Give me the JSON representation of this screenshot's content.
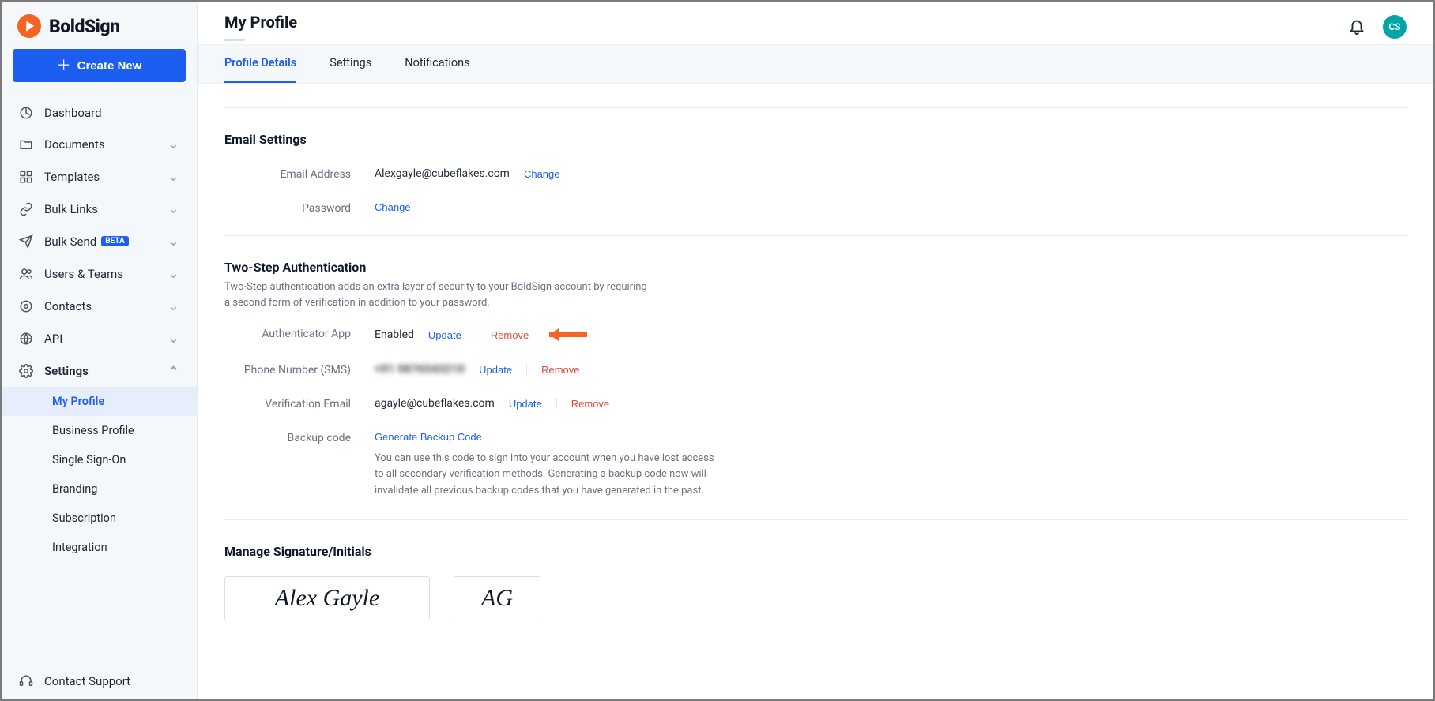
{
  "brand": {
    "name": "BoldSign"
  },
  "createButton": "Create New",
  "nav": {
    "dashboard": "Dashboard",
    "documents": "Documents",
    "templates": "Templates",
    "bulkLinks": "Bulk Links",
    "bulkSend": "Bulk Send",
    "bulkSendBadge": "BETA",
    "usersTeams": "Users & Teams",
    "contacts": "Contacts",
    "api": "API",
    "settings": "Settings",
    "settingsSub": {
      "myProfile": "My Profile",
      "businessProfile": "Business Profile",
      "sso": "Single Sign-On",
      "branding": "Branding",
      "subscription": "Subscription",
      "integration": "Integration"
    },
    "contactSupport": "Contact Support"
  },
  "header": {
    "pageTitle": "My Profile",
    "avatarInitials": "CS"
  },
  "tabs": {
    "profileDetails": "Profile Details",
    "settings": "Settings",
    "notifications": "Notifications"
  },
  "emailSettings": {
    "title": "Email Settings",
    "emailLabel": "Email Address",
    "emailValue": "Alexgayle@cubeflakes.com",
    "emailChange": "Change",
    "passwordLabel": "Password",
    "passwordChange": "Change"
  },
  "twoStep": {
    "title": "Two-Step Authentication",
    "desc": "Two-Step authentication adds an extra layer of security to your BoldSign account by requiring a second form of verification in addition to your password.",
    "authAppLabel": "Authenticator App",
    "authAppStatus": "Enabled",
    "update": "Update",
    "remove": "Remove",
    "phoneLabel": "Phone Number (SMS)",
    "phoneValue": "+91 9876543210",
    "verifEmailLabel": "Verification Email",
    "verifEmailValue": "agayle@cubeflakes.com",
    "backupLabel": "Backup code",
    "backupLink": "Generate Backup Code",
    "backupDesc": "You can use this code to sign into your account when you have lost access to all secondary verification methods. Generating a backup code now will invalidate all previous backup codes that you have generated in the past."
  },
  "signature": {
    "title": "Manage Signature/Initials",
    "fullName": "Alex Gayle",
    "initials": "AG"
  }
}
